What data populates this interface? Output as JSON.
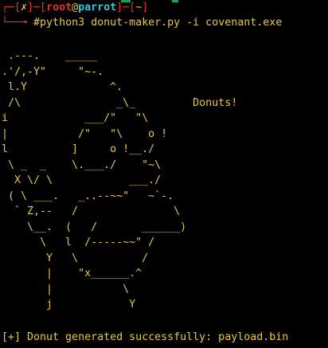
{
  "theme": {
    "background": "#000000",
    "text_yellow": "#e6c84a",
    "accent_red": "#e0342c",
    "accent_cyan": "#3fc2d9",
    "top_strip_green": "#16a34a"
  },
  "prompt": {
    "bracket_open": "┌─[",
    "status_mark": "✗",
    "sep1": "]─[",
    "user": "root",
    "at": "@",
    "host": "parrot",
    "sep2": "]─[",
    "cwd": "~",
    "bracket_close": "]",
    "line2_prefix": "└──╼ ",
    "symbol": "#",
    "command": "python3 donut-maker.py -i covenant.exe"
  },
  "ascii_art": " .---.    _____\n.'/,-Y\"     \"~-.\n l.Y             ^.\n /\\               _\\_         Donuts!\ni            ___/\"   \"\\\n|           /\"   \"\\    o !\nl          ]     o !__./\n \\ _  _    \\.___./    \"~\\\n  X \\/ \\            ___./\n ( \\ ___.   _..--~~\"   ~`-.\n  ` Z,--   /               \\\n    \\__.  (   /       ______)\n      \\   l  /-----~~\" /\n       Y   \\          /\n       |    \"x______.^\n       |           \\\n       j            Y",
  "status": {
    "message": "[+] Donut generated successfully: payload.bin"
  }
}
